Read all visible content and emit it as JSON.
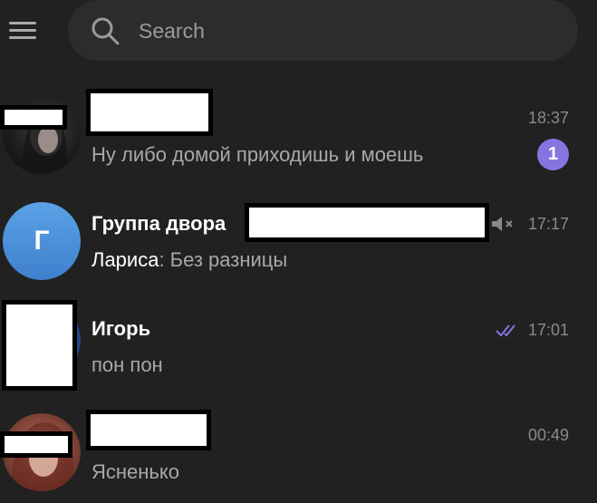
{
  "search": {
    "placeholder": "Search"
  },
  "chats": [
    {
      "name": "",
      "time": "18:37",
      "preview": "Ну либо домой приходишь и моешь",
      "unread": "1"
    },
    {
      "name": "Группа двора",
      "avatar_letter": "Г",
      "time": "17:17",
      "sender": "Лариса",
      "preview": "Без разницы",
      "muted": true
    },
    {
      "name": "Игорь",
      "time": "17:01",
      "preview": "пон пон",
      "read": true
    },
    {
      "name": "",
      "time": "00:49",
      "preview": "Ясненько"
    }
  ],
  "colors": {
    "background": "#212121",
    "search_bg": "#2c2c2c",
    "accent": "#8774e1",
    "avatar_blue": "#4f8fd8"
  },
  "icons": [
    "menu-icon",
    "search-icon",
    "mute-icon",
    "double-check-icon"
  ]
}
